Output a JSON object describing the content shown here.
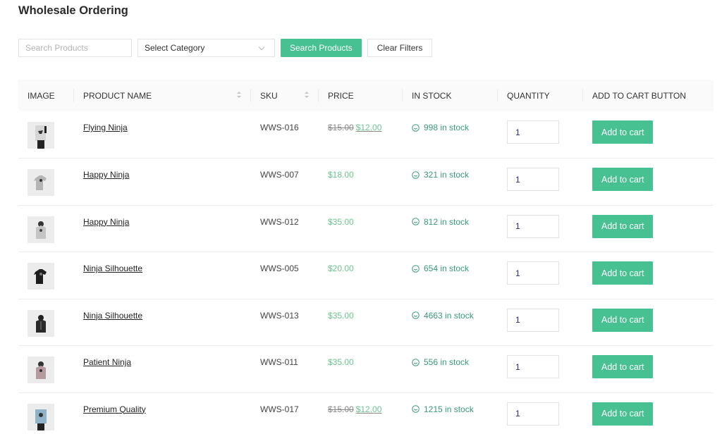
{
  "page": {
    "title": "Wholesale Ordering"
  },
  "filters": {
    "search_placeholder": "Search Products",
    "search_value": "",
    "category_selected": "Select Category",
    "search_button": "Search Products",
    "clear_button": "Clear Filters"
  },
  "colors": {
    "accent": "#47c092",
    "price": "#6cc68e",
    "stock": "#3a9a78"
  },
  "table": {
    "headers": {
      "image": "IMAGE",
      "name": "PRODUCT NAME",
      "sku": "SKU",
      "price": "PRICE",
      "stock": "IN STOCK",
      "quantity": "QUANTITY",
      "cart": "ADD TO CART BUTTON"
    },
    "rows": [
      {
        "image": "poster-flying-ninja",
        "name": "Flying Ninja",
        "sku": "WWS-016",
        "regular_price": "$15.00",
        "price": "$12.00",
        "on_sale": true,
        "stock": "998 in stock",
        "quantity": "1",
        "cart_label": "Add to cart"
      },
      {
        "image": "tshirt-grey",
        "name": "Happy Ninja",
        "sku": "WWS-007",
        "regular_price": "",
        "price": "$18.00",
        "on_sale": false,
        "stock": "321 in stock",
        "quantity": "1",
        "cart_label": "Add to cart"
      },
      {
        "image": "hoodie-grey",
        "name": "Happy Ninja",
        "sku": "WWS-012",
        "regular_price": "",
        "price": "$35.00",
        "on_sale": false,
        "stock": "812 in stock",
        "quantity": "1",
        "cart_label": "Add to cart"
      },
      {
        "image": "tshirt-black",
        "name": "Ninja Silhouette",
        "sku": "WWS-005",
        "regular_price": "",
        "price": "$20.00",
        "on_sale": false,
        "stock": "654 in stock",
        "quantity": "1",
        "cart_label": "Add to cart"
      },
      {
        "image": "hoodie-black",
        "name": "Ninja Silhouette",
        "sku": "WWS-013",
        "regular_price": "",
        "price": "$35.00",
        "on_sale": false,
        "stock": "4663 in stock",
        "quantity": "1",
        "cart_label": "Add to cart"
      },
      {
        "image": "hoodie-pink",
        "name": "Patient Ninja",
        "sku": "WWS-011",
        "regular_price": "",
        "price": "$35.00",
        "on_sale": false,
        "stock": "556 in stock",
        "quantity": "1",
        "cart_label": "Add to cart"
      },
      {
        "image": "poster-blue",
        "name": "Premium Quality",
        "sku": "WWS-017",
        "regular_price": "$15.00",
        "price": "$12.00",
        "on_sale": true,
        "stock": "1215 in stock",
        "quantity": "1",
        "cart_label": "Add to cart"
      }
    ]
  }
}
